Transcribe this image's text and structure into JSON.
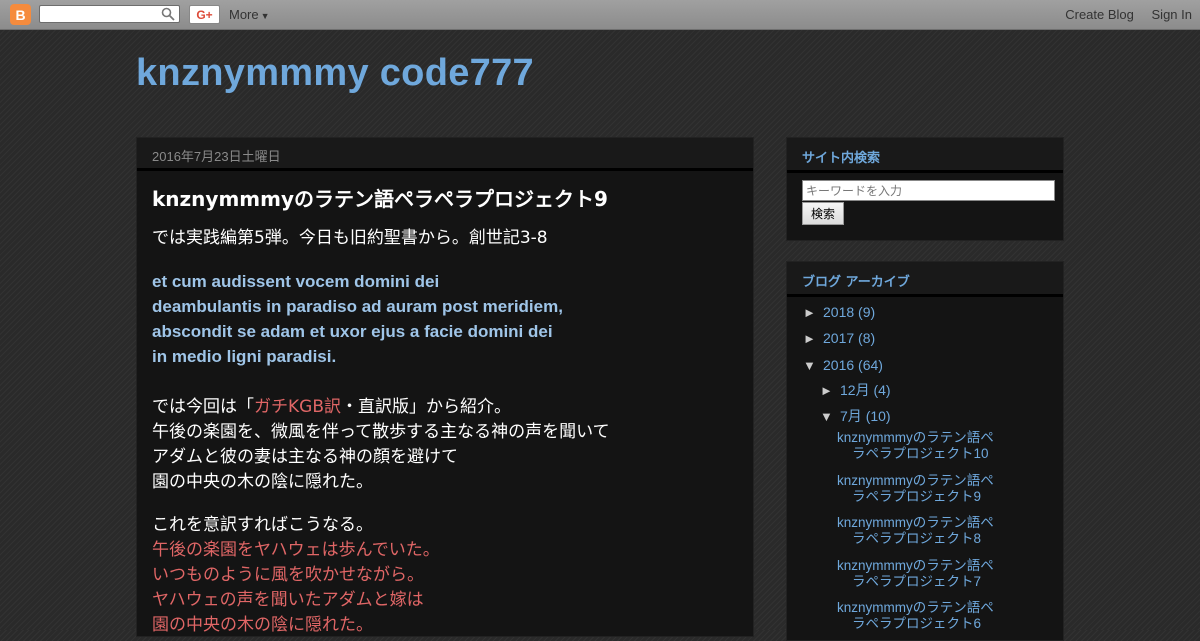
{
  "navbar": {
    "more_label": "More",
    "gplus_label": "G+",
    "create_blog": "Create Blog",
    "sign_in": "Sign In"
  },
  "blog": {
    "title": "knznymmmy code777"
  },
  "post": {
    "date": "2016年7月23日土曜日",
    "title": "knznymmmyのラテン語ペラペラプロジェクト9",
    "intro": "では実践編第5弾。今日も旧約聖書から。創世記3-8",
    "latin": [
      "et cum audissent vocem domini dei",
      "deambulantis in paradiso ad auram post meridiem,",
      "abscondit se adam et uxor ejus a facie domini dei",
      "in medio ligni paradisi."
    ],
    "kgb_prefix": "では今回は「",
    "kgb_link": "ガチKGB訳",
    "kgb_suffix": "・直訳版」から紹介。",
    "literal": [
      "午後の楽園を、微風を伴って散歩する主なる神の声を聞いて",
      "アダムと彼の妻は主なる神の顔を避けて",
      "園の中央の木の陰に隠れた。"
    ],
    "free_intro": "これを意訳すればこうなる。",
    "free": [
      "午後の楽園をヤハウェは歩んでいた。",
      "いつものように風を吹かせながら。",
      "ヤハウェの声を聞いたアダムと嫁は",
      "園の中央の木の陰に隠れた。"
    ]
  },
  "sidebar": {
    "search": {
      "title": "サイト内検索",
      "placeholder": "キーワードを入力",
      "button": "検索"
    },
    "archive": {
      "title": "ブログ アーカイブ",
      "years": [
        {
          "toggle": "►",
          "label": "2018",
          "count": "(9)"
        },
        {
          "toggle": "►",
          "label": "2017",
          "count": "(8)"
        },
        {
          "toggle": "▼",
          "label": "2016",
          "count": "(64)"
        }
      ],
      "months": [
        {
          "toggle": "►",
          "label": "12月",
          "count": "(4)"
        },
        {
          "toggle": "▼",
          "label": "7月",
          "count": "(10)"
        }
      ],
      "posts": [
        {
          "l1": "knznymmmyのラテン語ペ",
          "l2": "ラペラプロジェクト10"
        },
        {
          "l1": "knznymmmyのラテン語ペ",
          "l2": "ラペラプロジェクト9"
        },
        {
          "l1": "knznymmmyのラテン語ペ",
          "l2": "ラペラプロジェクト8"
        },
        {
          "l1": "knznymmmyのラテン語ペ",
          "l2": "ラペラプロジェクト7"
        },
        {
          "l1": "knznymmmyのラテン語ペ",
          "l2": "ラペラプロジェクト6"
        }
      ]
    }
  },
  "colors": {
    "link_blue": "#6fa8dc",
    "latin_blue": "#9fc5e8",
    "accent_red": "#e06666",
    "blogger_orange": "#f58b3d"
  },
  "icons": [
    "blogger-logo-icon",
    "search-icon",
    "triangle-right-icon",
    "triangle-down-icon"
  ]
}
